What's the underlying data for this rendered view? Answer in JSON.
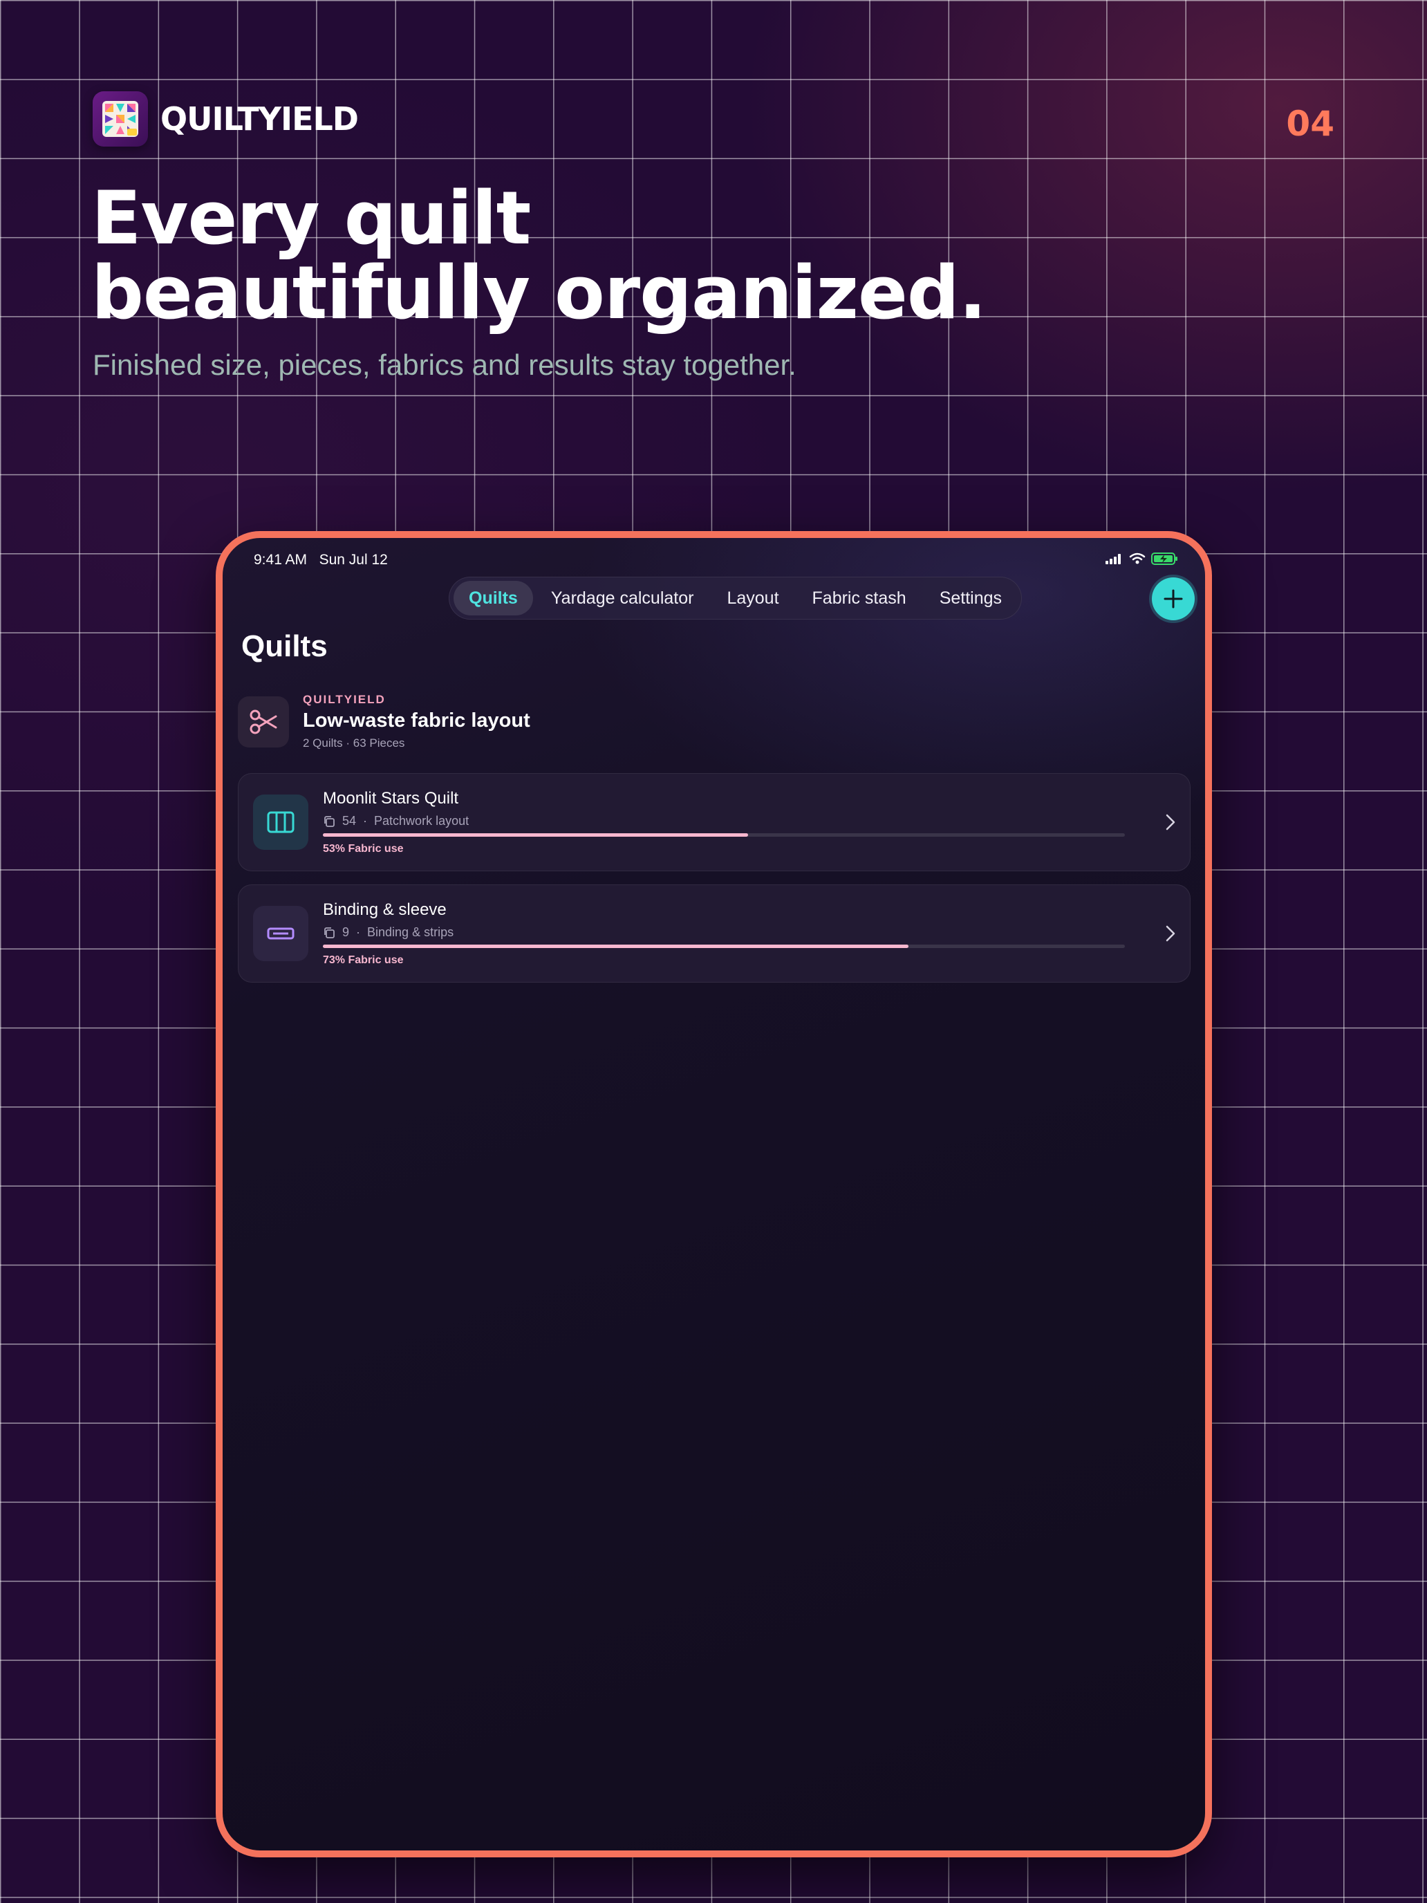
{
  "brand": {
    "name": "QUILTYIELD",
    "page_number": "04"
  },
  "hero": {
    "headline_line1": "Every quilt",
    "headline_line2": "beautifully organized.",
    "subhead": "Finished size, pieces, fabrics and results stay together."
  },
  "colors": {
    "accent_teal": "#38d9d4",
    "accent_pink": "#f7b7cf",
    "device_frame": "#f5725c",
    "page_number": "#ff7a5c"
  },
  "device": {
    "status": {
      "time": "9:41 AM",
      "date": "Sun Jul 12"
    },
    "tabs": [
      {
        "label": "Quilts",
        "active": true
      },
      {
        "label": "Yardage calculator",
        "active": false
      },
      {
        "label": "Layout",
        "active": false
      },
      {
        "label": "Fabric stash",
        "active": false
      },
      {
        "label": "Settings",
        "active": false
      }
    ],
    "add_icon": "plus-icon",
    "page_title": "Quilts",
    "summary": {
      "icon": "scissors-icon",
      "eyebrow": "QUILTYIELD",
      "title": "Low-waste fabric layout",
      "meta": "2 Quilts · 63 Pieces"
    },
    "quilts": [
      {
        "title": "Moonlit Stars Quilt",
        "icon": "columns-icon",
        "pieces": "54",
        "separator": "·",
        "category": "Patchwork layout",
        "fabric_use": 0.53,
        "fabric_use_label": "53% Fabric use"
      },
      {
        "title": "Binding & sleeve",
        "icon": "ruler-icon",
        "pieces": "9",
        "separator": "·",
        "category": "Binding & strips",
        "fabric_use": 0.73,
        "fabric_use_label": "73% Fabric use"
      }
    ]
  }
}
